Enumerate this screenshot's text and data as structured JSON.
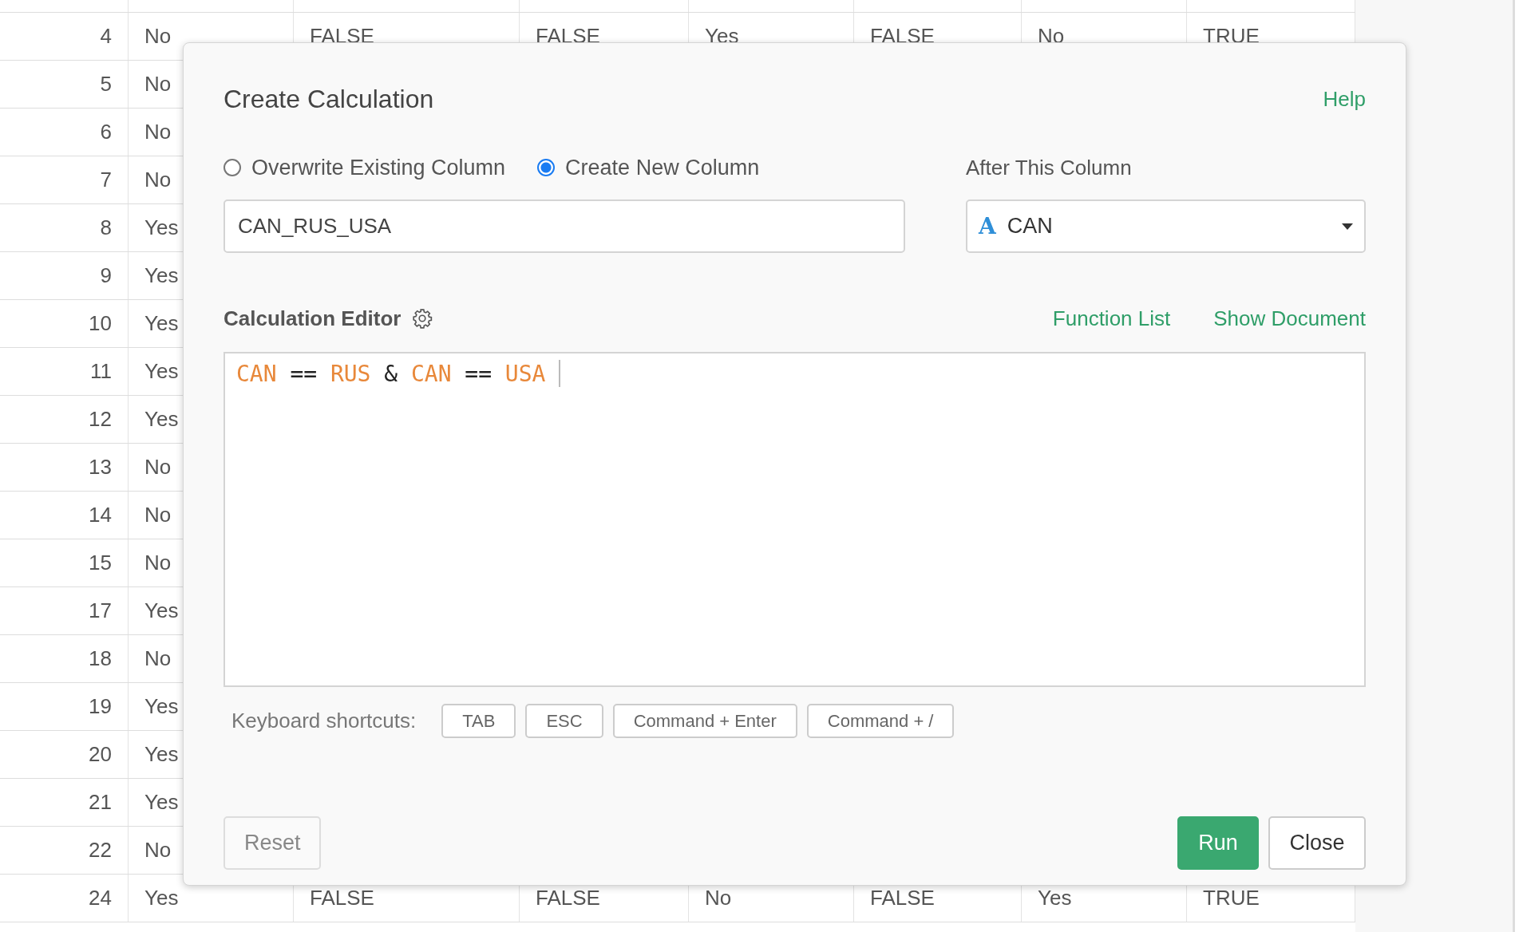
{
  "table": {
    "rows": [
      {
        "index": "4",
        "cells": [
          "No",
          "FALSE",
          "FALSE",
          "Yes",
          "FALSE",
          "No",
          "TRUE"
        ]
      },
      {
        "index": "5",
        "cells": [
          "No"
        ]
      },
      {
        "index": "6",
        "cells": [
          "No"
        ]
      },
      {
        "index": "7",
        "cells": [
          "No"
        ]
      },
      {
        "index": "8",
        "cells": [
          "Yes"
        ]
      },
      {
        "index": "9",
        "cells": [
          "Yes"
        ]
      },
      {
        "index": "10",
        "cells": [
          "Yes"
        ]
      },
      {
        "index": "11",
        "cells": [
          "Yes"
        ]
      },
      {
        "index": "12",
        "cells": [
          "Yes"
        ]
      },
      {
        "index": "13",
        "cells": [
          "No"
        ]
      },
      {
        "index": "14",
        "cells": [
          "No"
        ]
      },
      {
        "index": "15",
        "cells": [
          "No"
        ]
      },
      {
        "index": "17",
        "cells": [
          "Yes"
        ]
      },
      {
        "index": "18",
        "cells": [
          "No"
        ]
      },
      {
        "index": "19",
        "cells": [
          "Yes"
        ]
      },
      {
        "index": "20",
        "cells": [
          "Yes"
        ]
      },
      {
        "index": "21",
        "cells": [
          "Yes"
        ]
      },
      {
        "index": "22",
        "cells": [
          "No"
        ]
      },
      {
        "index": "24",
        "cells": [
          "Yes",
          "FALSE",
          "FALSE",
          "No",
          "FALSE",
          "Yes",
          "TRUE"
        ]
      }
    ]
  },
  "dialog": {
    "title": "Create Calculation",
    "help_link": "Help",
    "mode_options": [
      {
        "label": "Overwrite Existing Column",
        "selected": false
      },
      {
        "label": "Create New Column",
        "selected": true
      }
    ],
    "column_name": {
      "value": "CAN_RUS_USA"
    },
    "after_label": "After This Column",
    "after_select": {
      "type_icon": "A",
      "value": "CAN"
    },
    "editor": {
      "label": "Calculation Editor",
      "links": [
        "Function List",
        "Show Document"
      ],
      "code": [
        {
          "text": "CAN",
          "kind": "column"
        },
        {
          "text": "==",
          "kind": "operator"
        },
        {
          "text": "RUS",
          "kind": "column"
        },
        {
          "text": "&",
          "kind": "operator"
        },
        {
          "text": "CAN",
          "kind": "column"
        },
        {
          "text": "==",
          "kind": "operator"
        },
        {
          "text": "USA",
          "kind": "column"
        }
      ]
    },
    "shortcuts_label": "Keyboard shortcuts:",
    "shortcuts": [
      "TAB",
      "ESC",
      "Command + Enter",
      "Command + /"
    ],
    "buttons": {
      "reset": "Reset",
      "run": "Run",
      "close": "Close"
    }
  }
}
